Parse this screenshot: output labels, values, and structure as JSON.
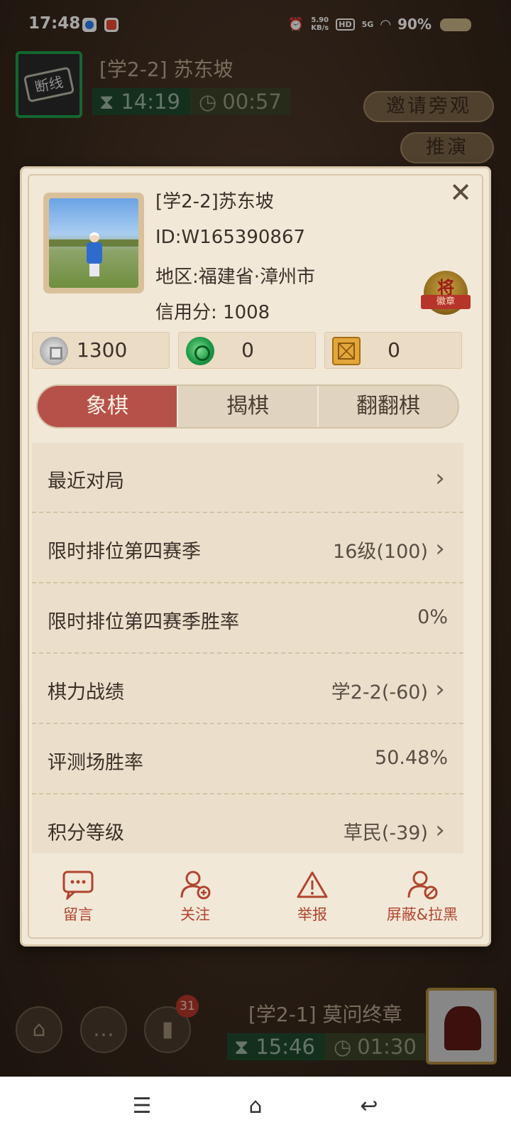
{
  "status_bar": {
    "time": "17:48",
    "net_speed": "5.90\nKB/s",
    "hd": "HD",
    "signal": "5G",
    "battery": "90%"
  },
  "opponent": {
    "name": "[学2-2] 苏东坡",
    "avatar_text": "断线",
    "timer_main": "14:19",
    "timer_step": "00:57"
  },
  "side_buttons": {
    "invite": "邀请旁观",
    "replay": "推演"
  },
  "self": {
    "name": "[学2-1] 莫问终章",
    "timer_main": "15:46",
    "timer_step": "01:30"
  },
  "bottom_controls": {
    "badge_count": "31"
  },
  "profile": {
    "name": "[学2-2]苏东坡",
    "id": "ID:W165390867",
    "region": "地区:福建省·漳州市",
    "credit": "信用分: 1008",
    "medal_char": "将",
    "medal_ribbon": "徽章"
  },
  "currencies": [
    {
      "icon": "silver-coin-icon",
      "value": "1300"
    },
    {
      "icon": "jade-icon",
      "value": "0"
    },
    {
      "icon": "chessboard-icon",
      "value": "0"
    }
  ],
  "tabs": [
    {
      "label": "象棋",
      "active": true
    },
    {
      "label": "揭棋",
      "active": false
    },
    {
      "label": "翻翻棋",
      "active": false
    }
  ],
  "stats": [
    {
      "label": "最近对局",
      "value": "",
      "arrow": true
    },
    {
      "label": "限时排位第四赛季",
      "value": "16级(100)",
      "arrow": true
    },
    {
      "label": "限时排位第四赛季胜率",
      "value": "0%",
      "arrow": false
    },
    {
      "label": "棋力战绩",
      "value": "学2-2(-60)",
      "arrow": true
    },
    {
      "label": "评测场胜率",
      "value": "50.48%",
      "arrow": false
    },
    {
      "label": "积分等级",
      "value": "草民(-39)",
      "arrow": true
    }
  ],
  "actions": {
    "message": "留言",
    "follow": "关注",
    "report": "举报",
    "block": "屏蔽&拉黑"
  },
  "colors": {
    "accent": "#b65149",
    "action": "#b0452e",
    "dialog_bg": "#f2e8d8"
  }
}
